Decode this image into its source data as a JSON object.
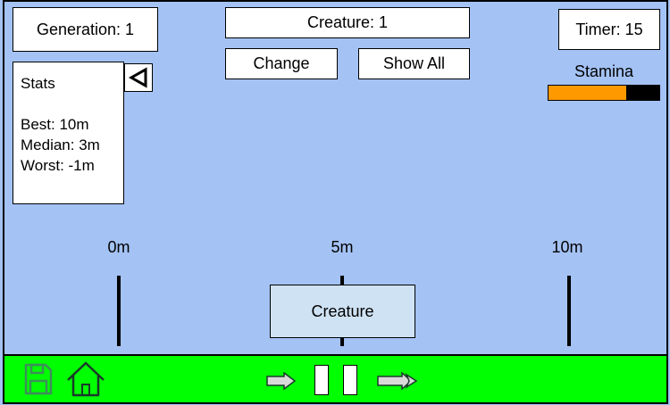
{
  "header": {
    "generation_label": "Generation: 1",
    "creature_label": "Creature: 1",
    "timer_label": "Timer: 15"
  },
  "buttons": {
    "change": "Change",
    "show_all": "Show All"
  },
  "stats": {
    "title": "Stats",
    "best": "Best: 10m",
    "median": "Median: 3m",
    "worst": "Worst: -1m"
  },
  "stamina": {
    "label": "Stamina",
    "level": 0.7,
    "fill_color": "#ff9900",
    "empty_color": "#000000"
  },
  "track": {
    "marks": [
      "0m",
      "5m",
      "10m"
    ]
  },
  "creature": {
    "label": "Creature"
  },
  "footer": {
    "icons": [
      "save-icon",
      "home-icon",
      "play-icon",
      "pause-icon",
      "fast-forward-icon"
    ],
    "color": "#00ff00"
  },
  "colors": {
    "background": "#a4c2f4",
    "creature_fill": "#cfe2f3",
    "footer": "#00ff00"
  }
}
